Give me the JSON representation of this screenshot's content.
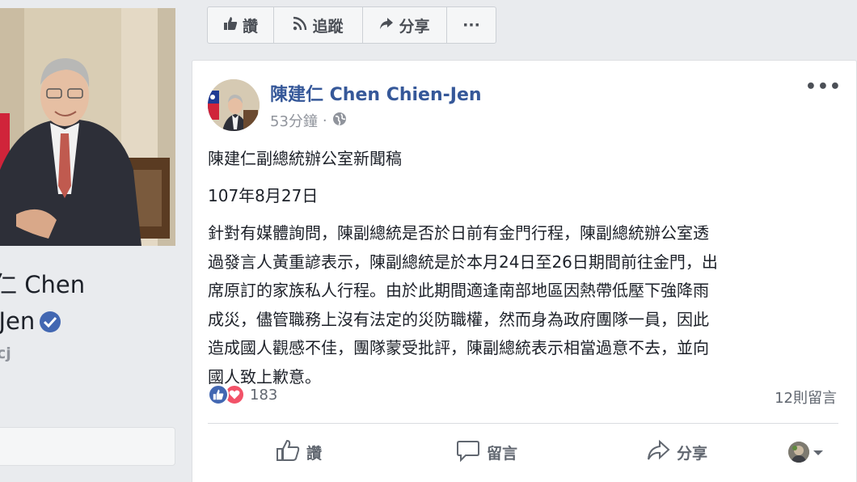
{
  "profile": {
    "name_line1": "仁 Chen",
    "name_line2": "n-Jen",
    "handle": "cj"
  },
  "top_actions": {
    "like_label": "讚",
    "follow_label": "追蹤",
    "share_label": "分享",
    "more_label": "···"
  },
  "post": {
    "author": "陳建仁 Chen Chien-Jen",
    "time": "53分鐘",
    "privacy_icon": "globe-icon",
    "title": "陳建仁副總統辦公室新聞稿",
    "date": "107年8月27日",
    "lines": [
      "針對有媒體詢問，陳副總統是否於日前有金門行程，陳副總統辦公室透",
      "過發言人黃重諺表示，陳副總統是於本月24日至26日期間前往金門，出",
      "席原訂的家族私人行程。由於此期間適逢南部地區因熱帶低壓下強降雨",
      "成災，儘管職務上沒有法定的災防職權，然而身為政府團隊一員，因此",
      "造成國人觀感不佳，團隊蒙受批評，陳副總統表示相當過意不去，並向",
      "國人致上歉意。"
    ],
    "reaction_count": "183",
    "comment_count": "12則留言",
    "more_label": "•••"
  },
  "bottom_actions": {
    "like_label": "讚",
    "comment_label": "留言",
    "share_label": "分享"
  },
  "colors": {
    "link": "#365899",
    "like_blue": "#4267b2",
    "love_red": "#f25268",
    "background": "#e9ebee"
  }
}
